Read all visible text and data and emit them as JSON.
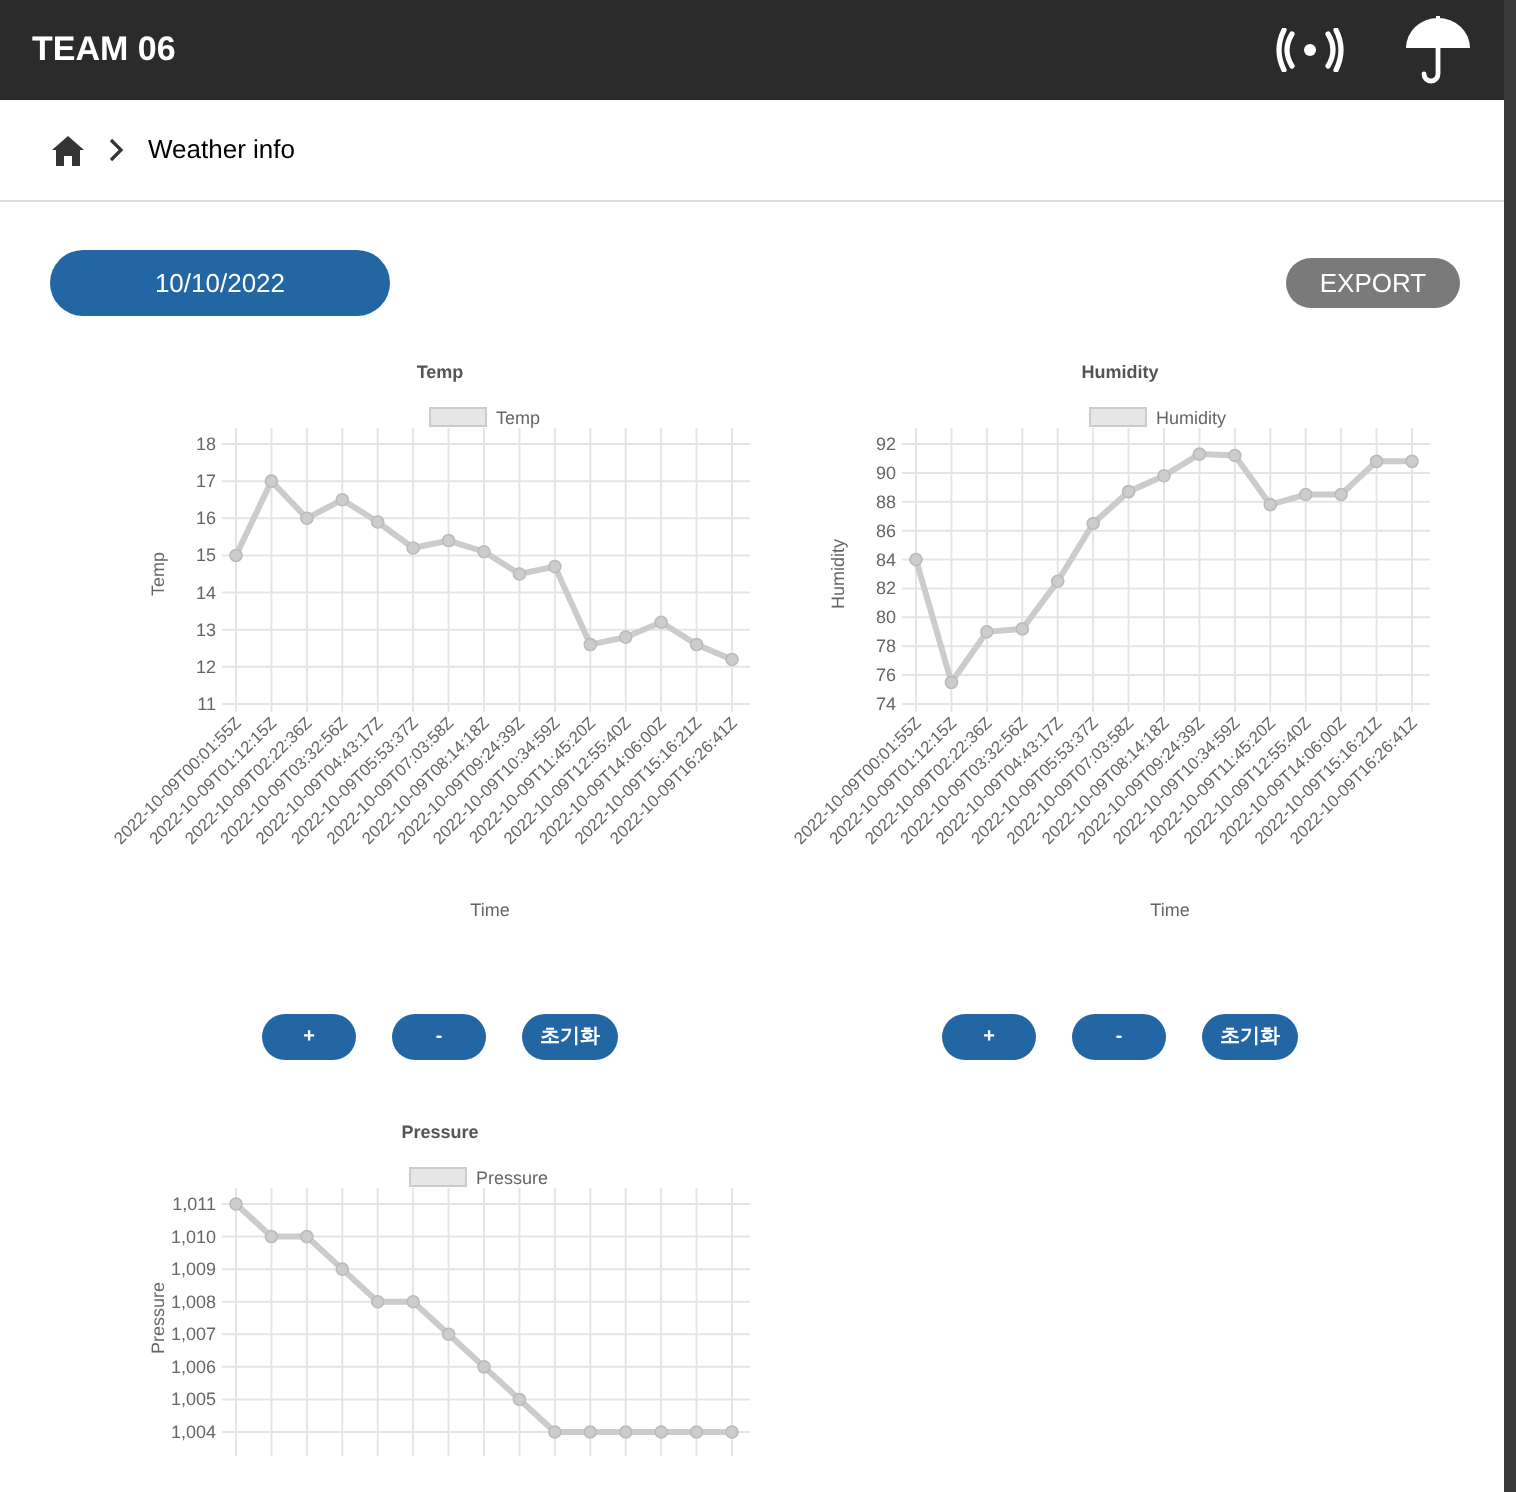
{
  "header": {
    "title": "TEAM 06"
  },
  "breadcrumb": {
    "label": "Weather info"
  },
  "date_button": "10/10/2022",
  "export_button": "EXPORT",
  "charts": [
    {
      "controls": [
        "+",
        "-",
        "초기화"
      ],
      "chart_data": {
        "type": "line",
        "title": "Temp",
        "xlabel": "Time",
        "ylabel": "Temp",
        "categories": [
          "2022-10-09T00:01:55Z",
          "2022-10-09T01:12:15Z",
          "2022-10-09T02:22:36Z",
          "2022-10-09T03:32:56Z",
          "2022-10-09T04:43:17Z",
          "2022-10-09T05:53:37Z",
          "2022-10-09T07:03:58Z",
          "2022-10-09T08:14:18Z",
          "2022-10-09T09:24:39Z",
          "2022-10-09T10:34:59Z",
          "2022-10-09T11:45:20Z",
          "2022-10-09T12:55:40Z",
          "2022-10-09T14:06:00Z",
          "2022-10-09T15:16:21Z",
          "2022-10-09T16:26:41Z"
        ],
        "grid": true,
        "series": [
          {
            "name": "Temp",
            "color": "#cccccc",
            "marker": true,
            "values": [
              15.0,
              17.0,
              16.0,
              16.5,
              15.9,
              15.2,
              15.4,
              15.1,
              14.5,
              14.7,
              12.6,
              12.8,
              13.2,
              12.6,
              12.2
            ]
          }
        ],
        "ylim": [
          11,
          18
        ],
        "yticks": [
          11,
          12,
          13,
          14,
          15,
          16,
          17,
          18
        ]
      }
    },
    {
      "controls": [
        "+",
        "-",
        "초기화"
      ],
      "chart_data": {
        "type": "line",
        "title": "Humidity",
        "xlabel": "Time",
        "ylabel": "Humidity",
        "categories": [
          "2022-10-09T00:01:55Z",
          "2022-10-09T01:12:15Z",
          "2022-10-09T02:22:36Z",
          "2022-10-09T03:32:56Z",
          "2022-10-09T04:43:17Z",
          "2022-10-09T05:53:37Z",
          "2022-10-09T07:03:58Z",
          "2022-10-09T08:14:18Z",
          "2022-10-09T09:24:39Z",
          "2022-10-09T10:34:59Z",
          "2022-10-09T11:45:20Z",
          "2022-10-09T12:55:40Z",
          "2022-10-09T14:06:00Z",
          "2022-10-09T15:16:21Z",
          "2022-10-09T16:26:41Z"
        ],
        "grid": true,
        "series": [
          {
            "name": "Humidity",
            "color": "#cccccc",
            "marker": true,
            "values": [
              84,
              75.5,
              79,
              79.2,
              82.5,
              86.5,
              88.7,
              89.8,
              91.3,
              91.2,
              87.8,
              88.5,
              88.5,
              90.8,
              90.8
            ]
          }
        ],
        "ylim": [
          74,
          92
        ],
        "yticks": [
          74,
          76,
          78,
          80,
          82,
          84,
          86,
          88,
          90,
          92
        ]
      }
    },
    {
      "chart_data": {
        "type": "line",
        "title": "Pressure",
        "ylabel": "Pressure",
        "grid": true,
        "series": [
          {
            "name": "Pressure",
            "color": "#cccccc",
            "marker": true,
            "values": [
              1011,
              1010,
              1010,
              1009,
              1008,
              1008,
              1007,
              1006,
              1005,
              1004,
              1004,
              1004,
              1004,
              1004,
              1004
            ]
          }
        ],
        "ylim": [
          1004,
          1011
        ],
        "yticks": [
          {
            "value": 1004,
            "label": "1,004"
          },
          {
            "value": 1005,
            "label": "1,005"
          },
          {
            "value": 1006,
            "label": "1,006"
          },
          {
            "value": 1007,
            "label": "1,007"
          },
          {
            "value": 1008,
            "label": "1,008"
          },
          {
            "value": 1009,
            "label": "1,009"
          },
          {
            "value": 1010,
            "label": "1,010"
          },
          {
            "value": 1011,
            "label": "1,011"
          }
        ]
      }
    }
  ]
}
